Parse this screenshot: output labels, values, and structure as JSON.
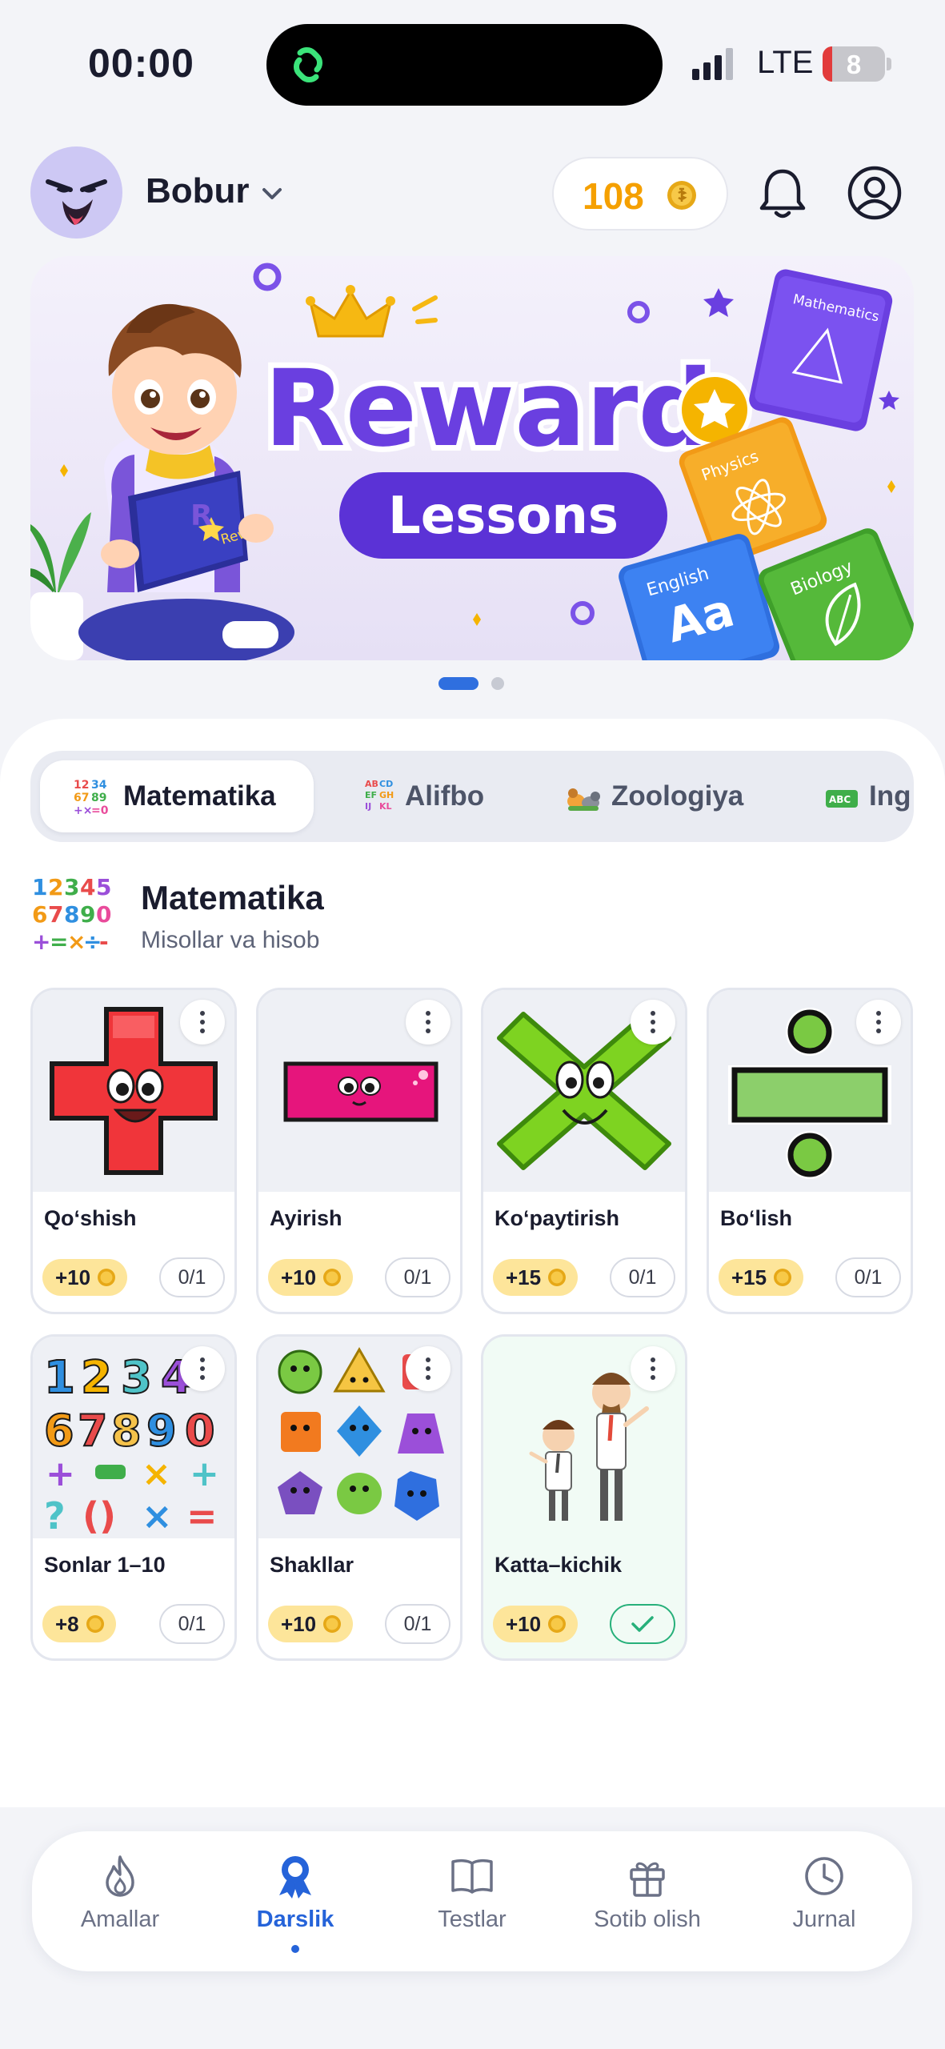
{
  "status_bar": {
    "time": "00:00",
    "network": "LTE",
    "battery": "8"
  },
  "header": {
    "username": "Bobur",
    "coins": "108"
  },
  "banner": {
    "brand": "Reward",
    "subtitle": "Lessons",
    "book_math": "Mathematics",
    "book_physics": "Physics",
    "book_english": "English",
    "book_english_aa": "Aa",
    "book_biology": "Biology",
    "book_kid": "Reward"
  },
  "tabs": [
    {
      "label": "Matematika",
      "active": true
    },
    {
      "label": "Alifbo"
    },
    {
      "label": "Zoologiya"
    },
    {
      "label": "Ing"
    }
  ],
  "section": {
    "title": "Matematika",
    "subtitle": "Misollar va hisob"
  },
  "lessons": [
    {
      "title": "Qo‘shish",
      "reward": "+10",
      "progress": "0/1"
    },
    {
      "title": "Ayirish",
      "reward": "+10",
      "progress": "0/1"
    },
    {
      "title": "Ko‘paytirish",
      "reward": "+15",
      "progress": "0/1"
    },
    {
      "title": "Bo‘lish",
      "reward": "+15",
      "progress": "0/1"
    },
    {
      "title": "Sonlar 1–10",
      "reward": "+8",
      "progress": "0/1"
    },
    {
      "title": "Shakllar",
      "reward": "+10",
      "progress": "0/1"
    },
    {
      "title": "Katta–kichik",
      "reward": "+10",
      "progress": "completed"
    }
  ],
  "nav": [
    {
      "label": "Amallar",
      "icon": "flame-icon"
    },
    {
      "label": "Darslik",
      "icon": "award-icon",
      "active": true
    },
    {
      "label": "Testlar",
      "icon": "book-icon"
    },
    {
      "label": "Sotib olish",
      "icon": "gift-icon"
    },
    {
      "label": "Jurnal",
      "icon": "clock-icon"
    }
  ],
  "colors": {
    "accent": "#2563d9",
    "coin": "#f5a000",
    "banner_purple": "#6a3fe0",
    "success": "#27b07a"
  }
}
